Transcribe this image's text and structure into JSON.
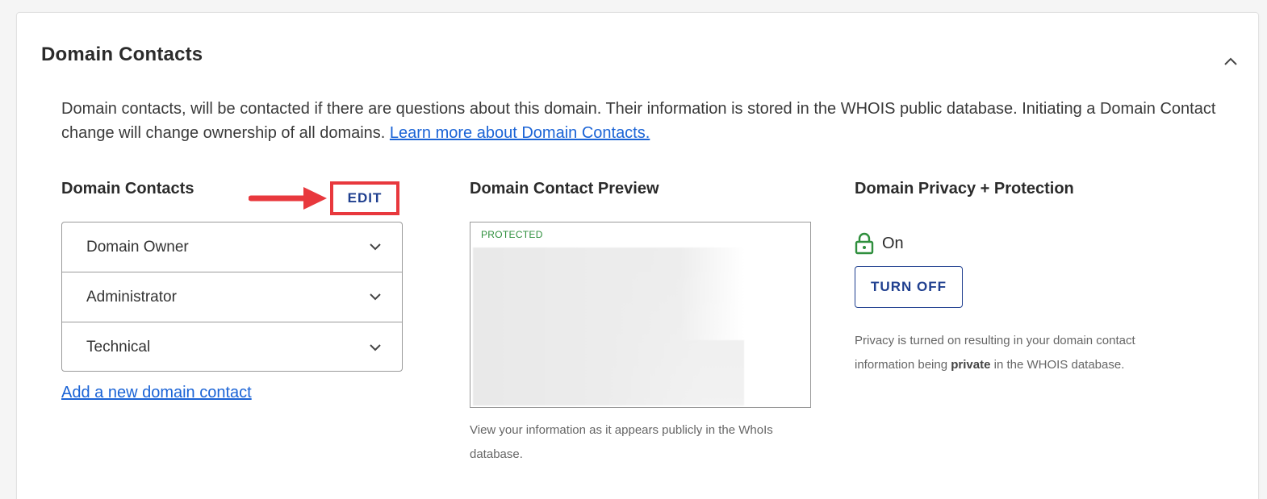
{
  "section": {
    "title": "Domain Contacts",
    "collapse_icon": "chevron-up-icon"
  },
  "description": {
    "text": "Domain contacts, will be contacted if there are questions about this domain. Their information is stored in the WHOIS public database. Initiating a Domain Contact change will change ownership of all domains. ",
    "link_text": "Learn more about Domain Contacts."
  },
  "contacts": {
    "heading": "Domain Contacts",
    "edit_label": "EDIT",
    "items": [
      {
        "label": "Domain Owner"
      },
      {
        "label": "Administrator"
      },
      {
        "label": "Technical"
      }
    ],
    "add_link": "Add a new domain contact"
  },
  "preview": {
    "heading": "Domain Contact Preview",
    "tag": "PROTECTED",
    "caption": "View your information as it appears publicly in the WhoIs database."
  },
  "privacy": {
    "heading": "Domain Privacy + Protection",
    "status": "On",
    "button_label": "TURN OFF",
    "note_before": "Privacy is turned on resulting in your domain contact information being ",
    "note_bold": "private",
    "note_after": " in the WHOIS database."
  },
  "colors": {
    "link": "#1a63d6",
    "primary": "#1f3f8f",
    "highlight": "#e8383d",
    "success": "#2f8f3d"
  }
}
